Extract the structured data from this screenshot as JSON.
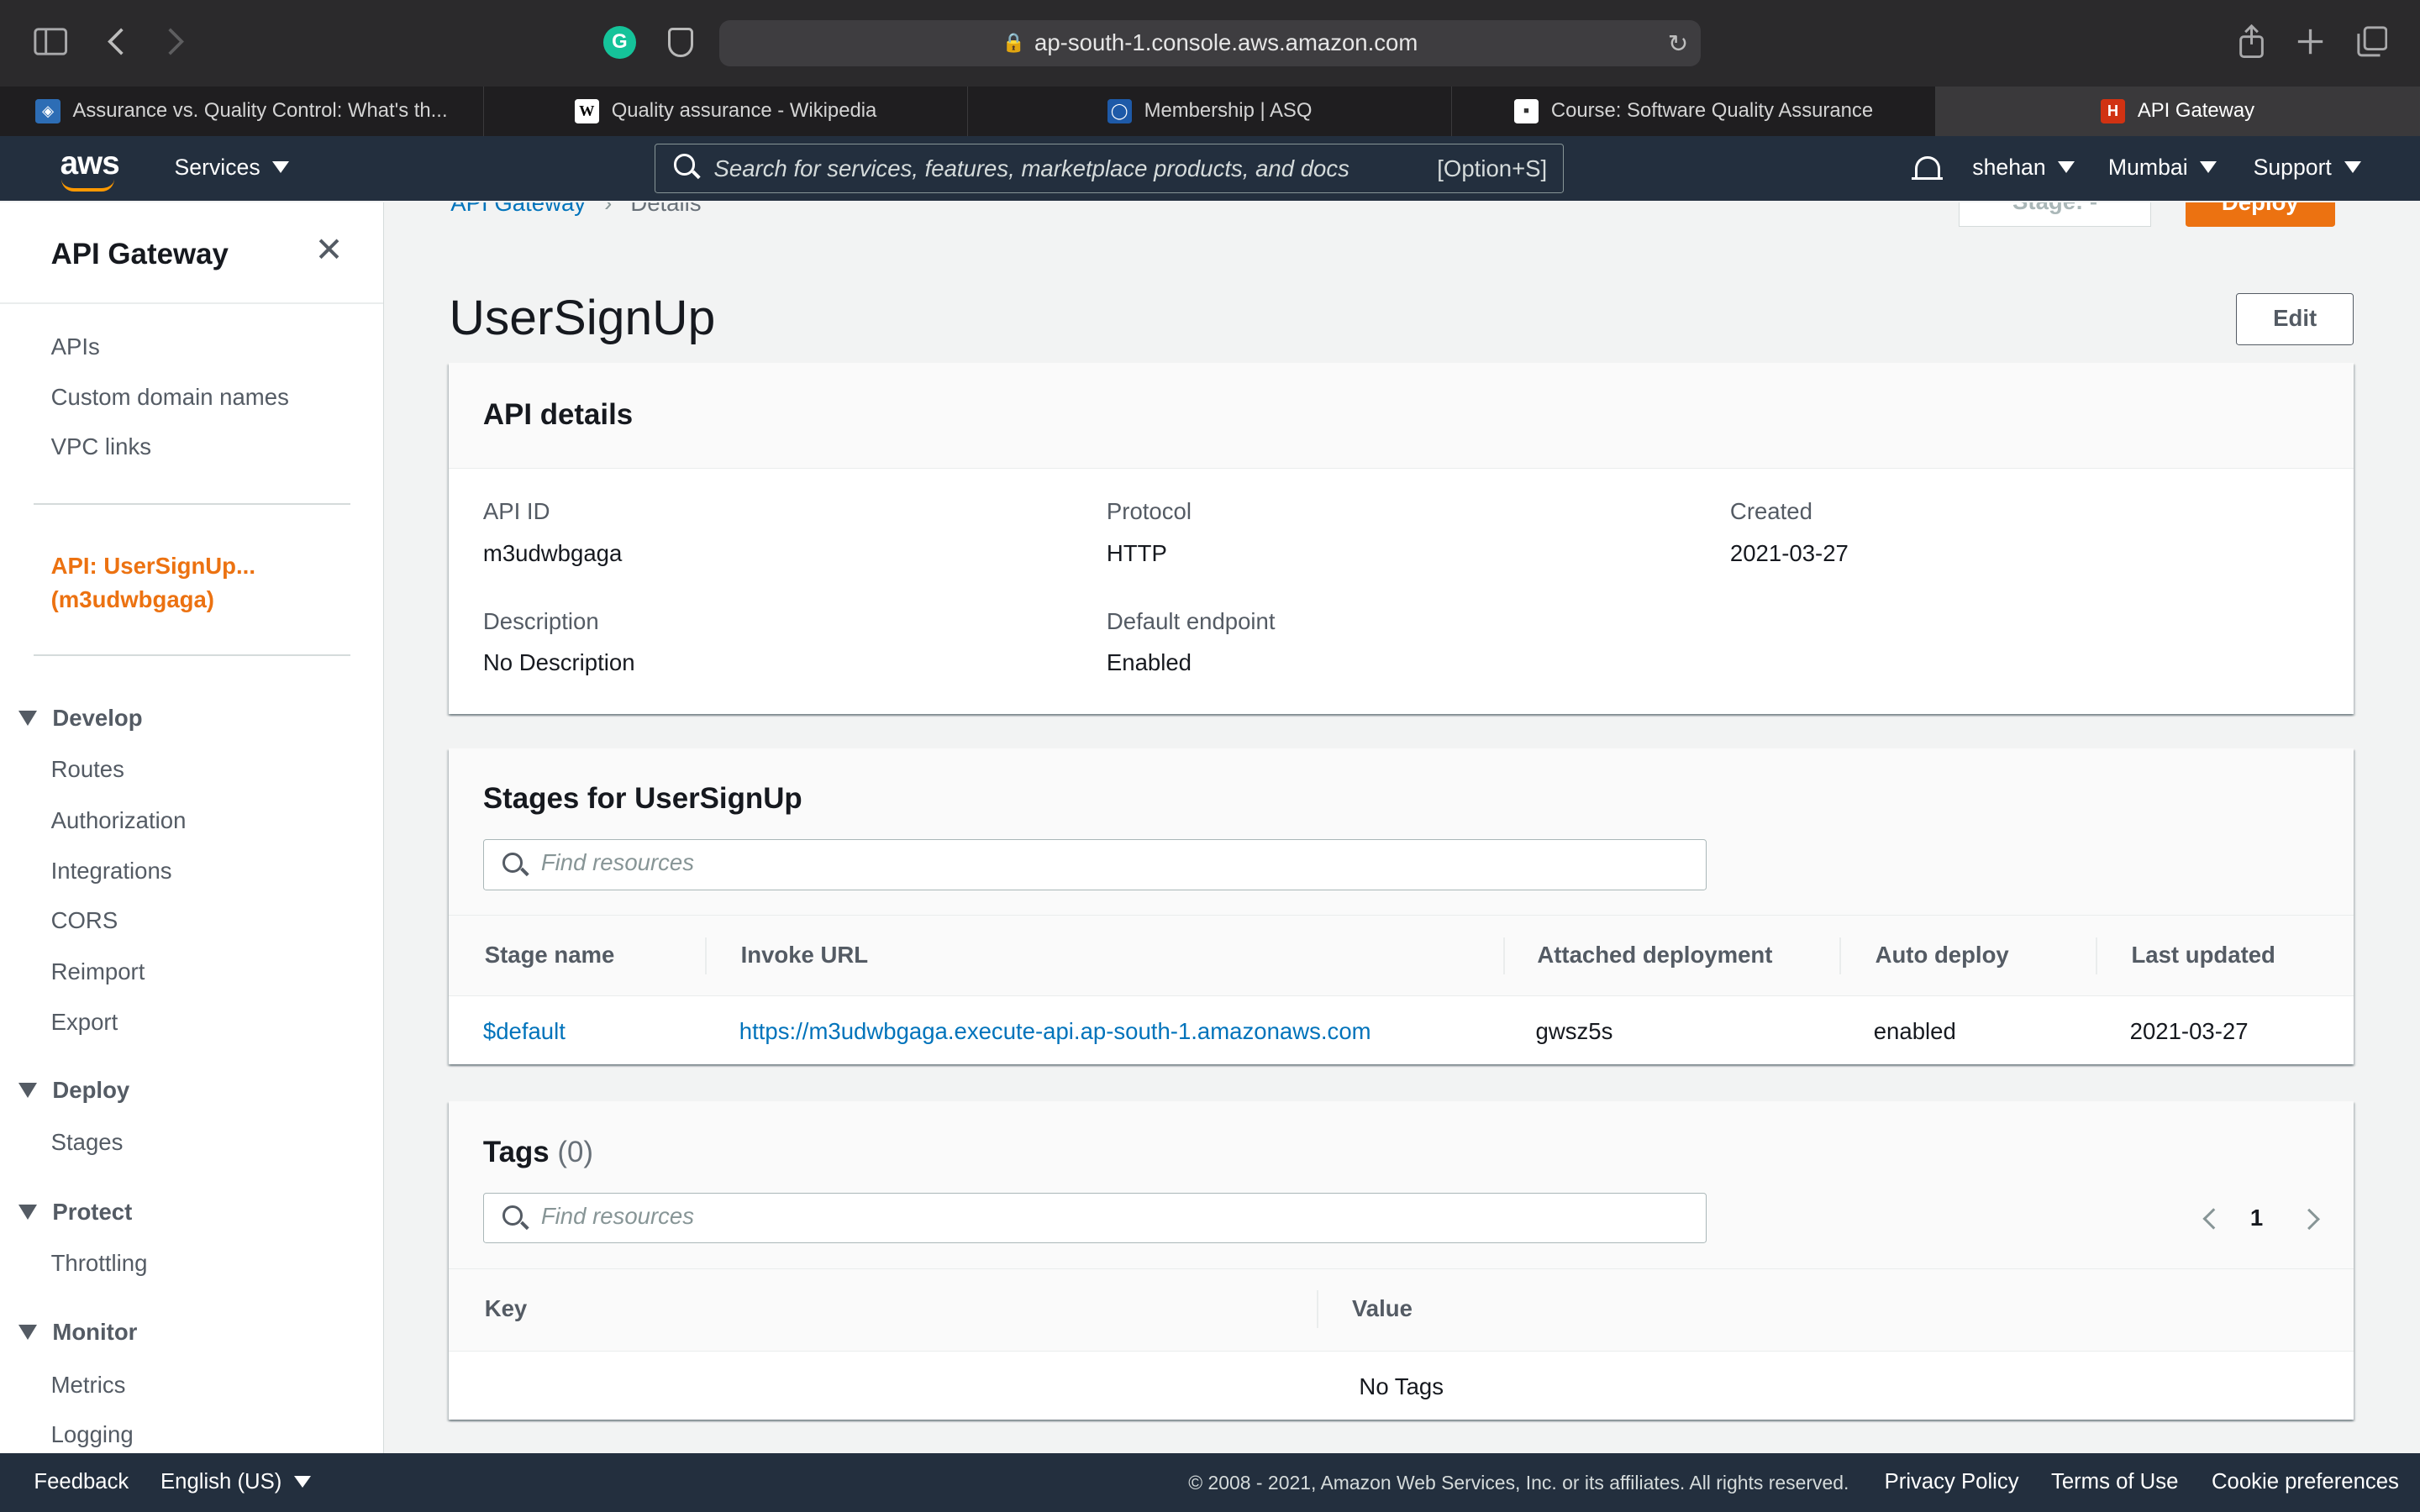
{
  "browser": {
    "url": "ap-south-1.console.aws.amazon.com",
    "tabs": [
      {
        "title": "Assurance vs. Quality Control: What's th...",
        "active": false
      },
      {
        "title": "Quality assurance - Wikipedia",
        "active": false
      },
      {
        "title": "Membership | ASQ",
        "active": false
      },
      {
        "title": "Course: Software Quality Assurance",
        "active": false
      },
      {
        "title": "API Gateway",
        "active": true
      }
    ],
    "ext_letter": "G"
  },
  "aws_nav": {
    "logo": "aws",
    "services": "Services",
    "search_placeholder": "Search for services, features, marketplace products, and docs",
    "search_hint": "[Option+S]",
    "user": "shehan",
    "region": "Mumbai",
    "support": "Support"
  },
  "sidebar": {
    "title": "API Gateway",
    "top_links": [
      "APIs",
      "Custom domain names",
      "VPC links"
    ],
    "current_api": {
      "line1": "API: UserSignUp...",
      "line2": "(m3udwbgaga)"
    },
    "sections": [
      {
        "title": "Develop",
        "items": [
          "Routes",
          "Authorization",
          "Integrations",
          "CORS",
          "Reimport",
          "Export"
        ]
      },
      {
        "title": "Deploy",
        "items": [
          "Stages"
        ]
      },
      {
        "title": "Protect",
        "items": [
          "Throttling"
        ]
      },
      {
        "title": "Monitor",
        "items": [
          "Metrics",
          "Logging"
        ]
      }
    ]
  },
  "header": {
    "breadcrumb_root": "API Gateway",
    "breadcrumb_current": "Details",
    "stage_button": "Stage: -",
    "deploy_button": "Deploy",
    "title": "UserSignUp",
    "edit_button": "Edit"
  },
  "api_details": {
    "title": "API details",
    "api_id_label": "API ID",
    "api_id": "m3udwbgaga",
    "protocol_label": "Protocol",
    "protocol": "HTTP",
    "created_label": "Created",
    "created": "2021-03-27",
    "description_label": "Description",
    "description": "No Description",
    "endpoint_label": "Default endpoint",
    "endpoint": "Enabled"
  },
  "stages": {
    "title": "Stages for UserSignUp",
    "filter_placeholder": "Find resources",
    "columns": [
      "Stage name",
      "Invoke URL",
      "Attached deployment",
      "Auto deploy",
      "Last updated"
    ],
    "rows": [
      {
        "stage": "$default",
        "url": "https://m3udwbgaga.execute-api.ap-south-1.amazonaws.com",
        "deployment": "gwsz5s",
        "auto_deploy": "enabled",
        "updated": "2021-03-27"
      }
    ]
  },
  "tags": {
    "title": "Tags",
    "count": "(0)",
    "filter_placeholder": "Find resources",
    "page": "1",
    "columns": [
      "Key",
      "Value"
    ],
    "empty": "No Tags"
  },
  "footer": {
    "feedback": "Feedback",
    "language": "English (US)",
    "copyright": "© 2008 - 2021, Amazon Web Services, Inc. or its affiliates. All rights reserved.",
    "privacy": "Privacy Policy",
    "terms": "Terms of Use",
    "cookies": "Cookie preferences"
  },
  "colors": {
    "aws_nav": "#232f3e",
    "accent_orange": "#ec7211",
    "link_blue": "#0073bb",
    "page_bg": "#f2f3f3"
  }
}
